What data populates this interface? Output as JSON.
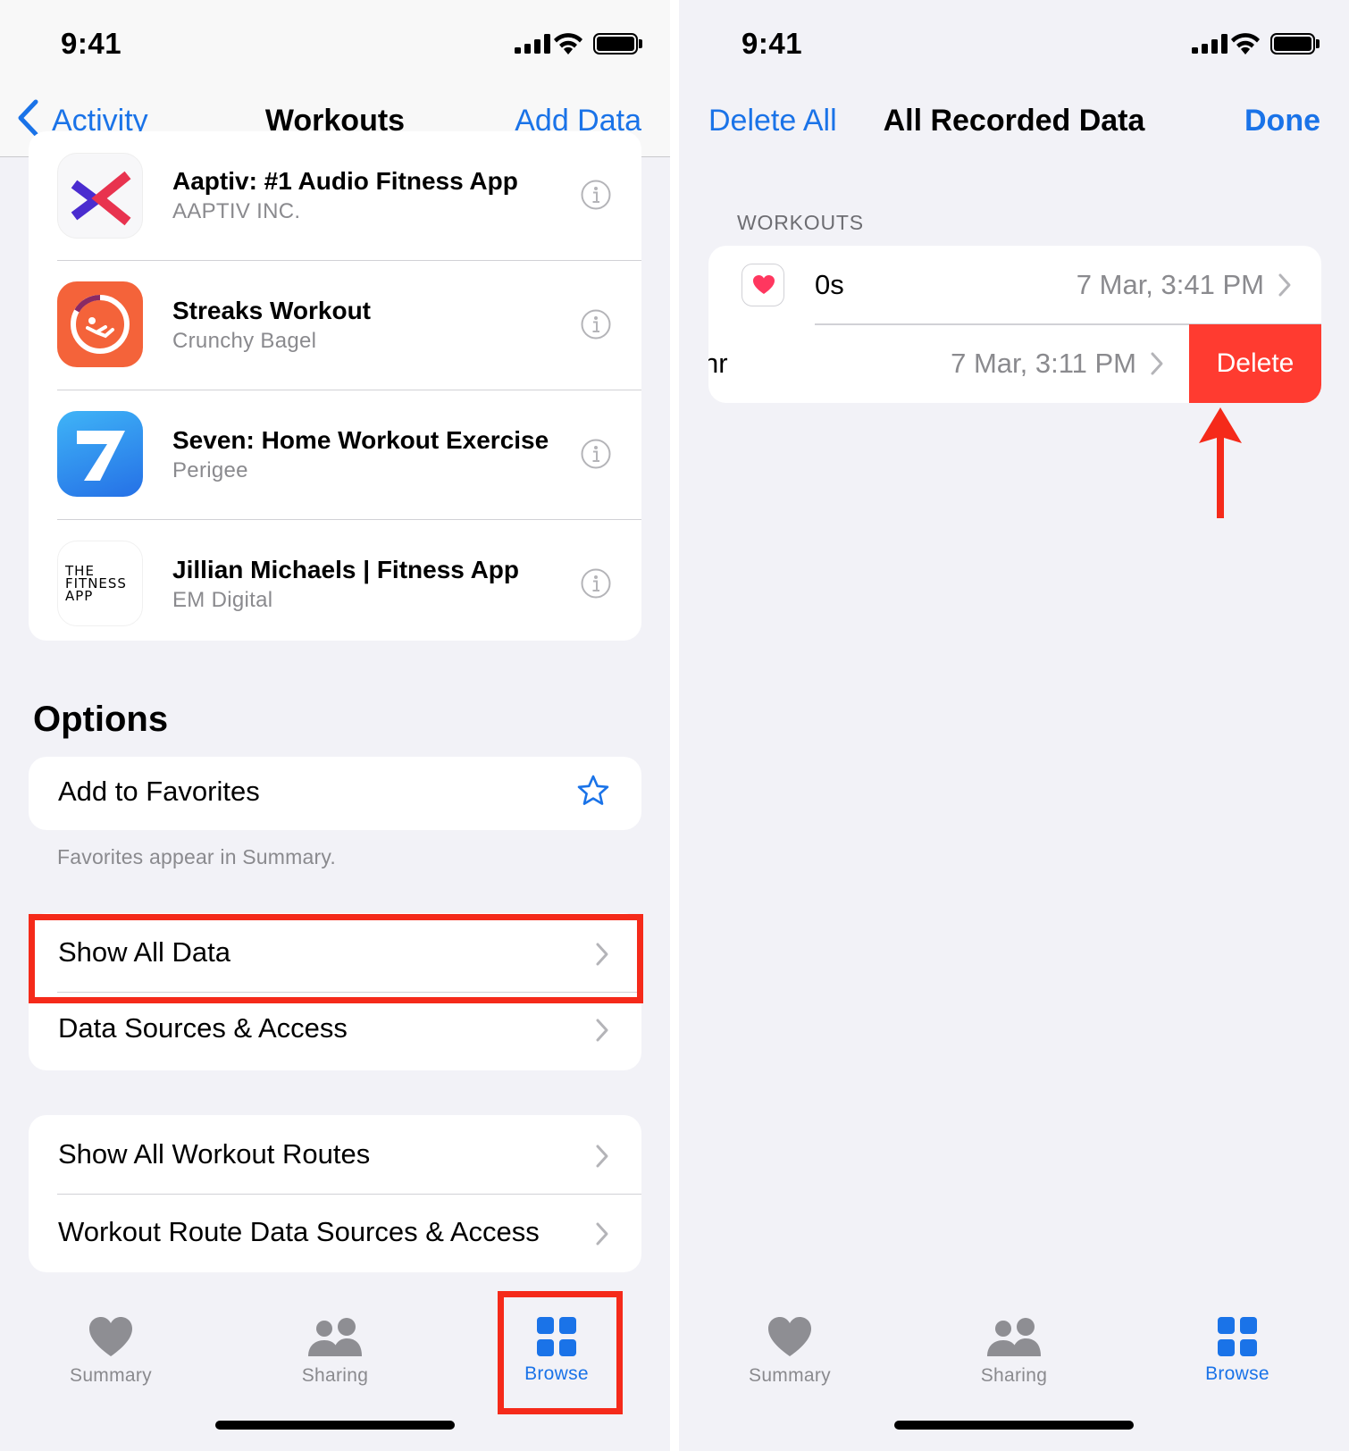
{
  "status_bar": {
    "time": "9:41"
  },
  "left": {
    "nav": {
      "back_label": "Activity",
      "title": "Workouts",
      "action_label": "Add Data"
    },
    "apps": [
      {
        "name": "Aaptiv: #1 Audio Fitness App",
        "developer": "AAPTIV INC.",
        "icon": "aaptiv-icon"
      },
      {
        "name": "Streaks Workout",
        "developer": "Crunchy Bagel",
        "icon": "streaks-icon"
      },
      {
        "name": "Seven: Home Workout Exercise",
        "developer": "Perigee",
        "icon": "seven-icon"
      },
      {
        "name": "Jillian Michaels | Fitness App",
        "developer": "EM Digital",
        "icon": "fitness-app-icon",
        "icon_text": [
          "THE",
          "FITNESS",
          "APP"
        ]
      }
    ],
    "options": {
      "title": "Options",
      "add_favorites": "Add to Favorites",
      "favorites_note": "Favorites appear in Summary.",
      "show_all_data": "Show All Data",
      "data_sources": "Data Sources & Access",
      "show_routes": "Show All Workout Routes",
      "route_sources": "Workout Route Data Sources & Access"
    }
  },
  "right": {
    "nav": {
      "left_label": "Delete All",
      "title": "All Recorded Data",
      "right_label": "Done"
    },
    "section_header": "WORKOUTS",
    "rows": [
      {
        "value": "0s",
        "date": "7 Mar, 3:41 PM"
      },
      {
        "value": "hr",
        "date": "7 Mar, 3:11 PM"
      }
    ],
    "delete_label": "Delete"
  },
  "tabs": [
    {
      "label": "Summary",
      "icon": "heart-icon",
      "active": false
    },
    {
      "label": "Sharing",
      "icon": "people-icon",
      "active": false
    },
    {
      "label": "Browse",
      "icon": "grid-icon",
      "active": true
    }
  ],
  "colors": {
    "accent": "#1a73e8",
    "highlight": "#f52a1a",
    "delete": "#ff3b30",
    "background": "#f2f2f7",
    "streaks": "#f4633a",
    "seven": "#2f8ef0"
  }
}
